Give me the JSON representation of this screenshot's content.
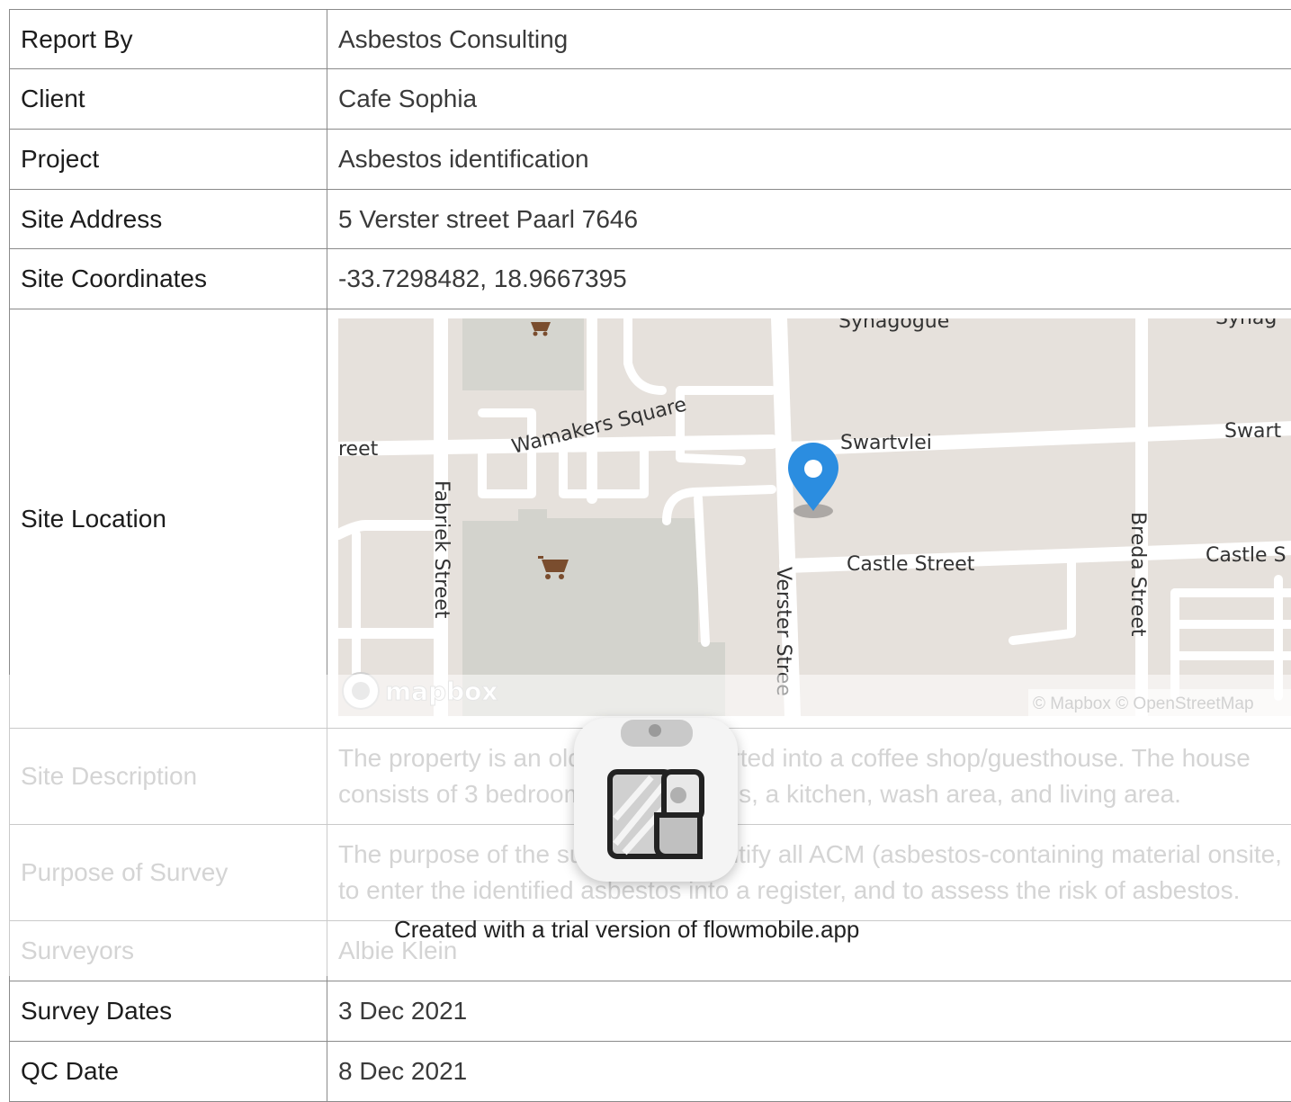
{
  "rows": [
    {
      "label": "Report By",
      "value": "Asbestos Consulting"
    },
    {
      "label": "Client",
      "value": "Cafe Sophia"
    },
    {
      "label": "Project",
      "value": "Asbestos identification"
    },
    {
      "label": "Site Address",
      "value": "5 Verster street Paarl 7646"
    },
    {
      "label": "Site Coordinates",
      "value": "-33.7298482, 18.9667395"
    },
    {
      "label": "Site Location"
    },
    {
      "label": "Site Description",
      "value": "The property is an old house converted into a coffee shop/guesthouse. The house consists of 3 bedrooms, 2 bathrooms, a kitchen, wash area, and living area."
    },
    {
      "label": "Purpose of Survey",
      "value": "The purpose of the survey is to identify all ACM (asbestos-containing material onsite, to enter the identified asbestos into a register, and to assess the risk of asbestos."
    },
    {
      "label": "Surveyors",
      "value": "Albie Klein"
    },
    {
      "label": "Survey Dates",
      "value": "3 Dec 2021"
    },
    {
      "label": "QC Date",
      "value": "8 Dec 2021"
    }
  ],
  "map": {
    "streets": {
      "wamakers": "Wamakers Square",
      "swartvlei": "Swartvlei",
      "swartvlei_right": "Swart",
      "castle": "Castle Street",
      "castle_right": "Castle S",
      "fabriek": "Fabriek Street",
      "verster": "Verster Stree",
      "breda": "Breda Street",
      "street_left": "reet",
      "synagogue": "Synagogue",
      "synagogue_right": "Synag"
    },
    "logo": "mapbox",
    "attribution": "© Mapbox © OpenStreetMap",
    "marker_color": "#2b8de0",
    "icons": [
      "shopping-cart-icon",
      "map-pin-icon"
    ]
  },
  "watermark": {
    "text": "Created with a trial version of flowmobile.app"
  }
}
